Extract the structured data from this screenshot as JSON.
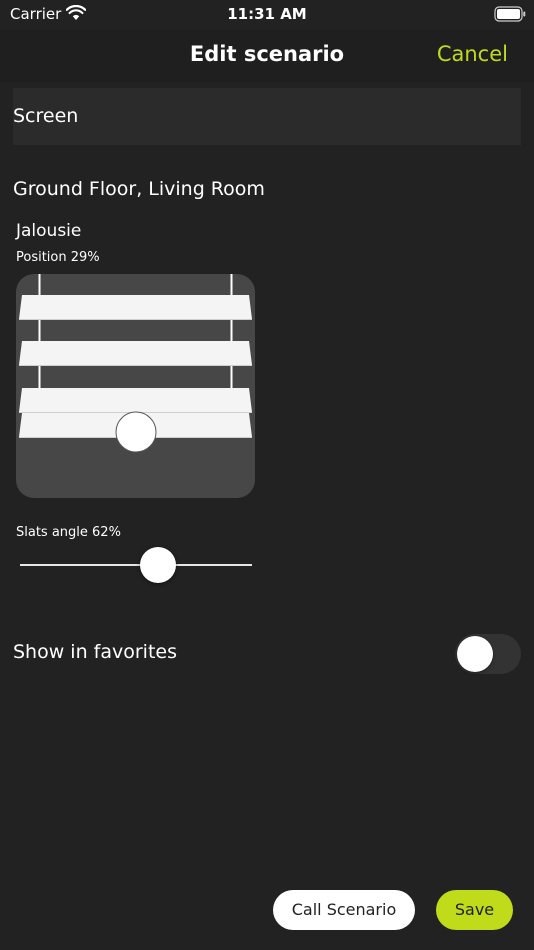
{
  "status_bar": {
    "carrier": "Carrier",
    "time": "11:31 AM",
    "icons": [
      "wifi-icon",
      "battery-icon"
    ]
  },
  "nav": {
    "title": "Edit scenario",
    "cancel_label": "Cancel"
  },
  "scenario": {
    "name_value": "Screen"
  },
  "device": {
    "location": "Ground Floor, Living Room",
    "name": "Jalousie",
    "position_label": "Position 29%",
    "position": 29,
    "slats_label": "Slats angle 62%",
    "slats_angle": 62
  },
  "favorites": {
    "label": "Show in favorites",
    "enabled": false
  },
  "actions": {
    "call_label": "Call Scenario",
    "save_label": "Save"
  },
  "colors": {
    "accent": "#bfdb1a",
    "background": "#222222",
    "panel": "#474747",
    "field": "#2b2b2b"
  }
}
